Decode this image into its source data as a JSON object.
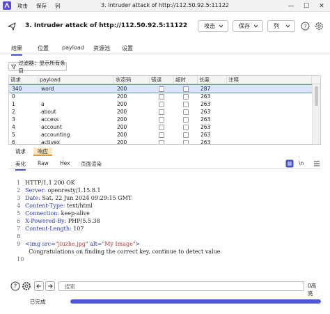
{
  "titlebar": {
    "menu": [
      "攻击",
      "保存",
      "列"
    ],
    "window_title": "3. Intruder attack of http://112.50.92.5:11122",
    "min": "—",
    "max": "☐",
    "close": "✕"
  },
  "header": {
    "title": "3. Intruder attack of http://112.50.92.5:11122",
    "attack_button": "攻击",
    "save_button": "保存",
    "columns_button": "列"
  },
  "tabs": [
    "结果",
    "位置",
    "payload",
    "资源池",
    "设置"
  ],
  "filter": {
    "label": "过滤器：显示所有条目"
  },
  "table": {
    "headers": [
      "请求",
      "payload",
      "状态码",
      "错误",
      "超时",
      "长度",
      "注释"
    ],
    "rows": [
      {
        "req": "340",
        "payload": "word",
        "status": "200",
        "length": "287",
        "selected": true
      },
      {
        "req": "0",
        "payload": "",
        "status": "200",
        "length": "263"
      },
      {
        "req": "1",
        "payload": "a",
        "status": "200",
        "length": "263"
      },
      {
        "req": "2",
        "payload": "about",
        "status": "200",
        "length": "263"
      },
      {
        "req": "3",
        "payload": "access",
        "status": "200",
        "length": "263"
      },
      {
        "req": "4",
        "payload": "account",
        "status": "200",
        "length": "263"
      },
      {
        "req": "5",
        "payload": "accounting",
        "status": "200",
        "length": "263"
      },
      {
        "req": "6",
        "payload": "activex",
        "status": "200",
        "length": "263"
      }
    ]
  },
  "reqresp_tabs": [
    "请求",
    "响应"
  ],
  "viewer_tabs": [
    "美化",
    "Raw",
    "Hex",
    "页面渲染"
  ],
  "viewer_wrap_label": "\\n",
  "response": {
    "lines": [
      {
        "n": "1",
        "text": "HTTP/1.1 200 OK"
      },
      {
        "n": "2",
        "name": "Server",
        "value": " openresty/1.15.8.1"
      },
      {
        "n": "3",
        "name": "Date",
        "value": " Sat, 22 Jun 2024 09:29:15 GMT"
      },
      {
        "n": "4",
        "name": "Content-Type",
        "value": " text/html"
      },
      {
        "n": "5",
        "name": "Connection",
        "value": " keep-alive"
      },
      {
        "n": "6",
        "name": "X-Powered-By",
        "value": " PHP/5.5.38"
      },
      {
        "n": "7",
        "name": "Content-Length",
        "value": " 107"
      },
      {
        "n": "8",
        "text": ""
      },
      {
        "n": "9",
        "html_tag": "<img src=",
        "html_src": "\"jiuzhe.jpg\"",
        "html_alt_key": " alt=",
        "html_alt": "\"My Image\"",
        "html_end": ">"
      },
      {
        "n": "",
        "text": "  Congratulations on finding the correct key, continue to detect value"
      },
      {
        "n": "10",
        "text": ""
      }
    ]
  },
  "footer": {
    "search_placeholder": "搜索",
    "hits": "0高亮"
  },
  "status": {
    "text": "已完成",
    "progress": 1.0
  },
  "colors": {
    "accent": "#4b58d6",
    "header_blue": "#2a38b5",
    "attr_red": "#b03a3a"
  }
}
